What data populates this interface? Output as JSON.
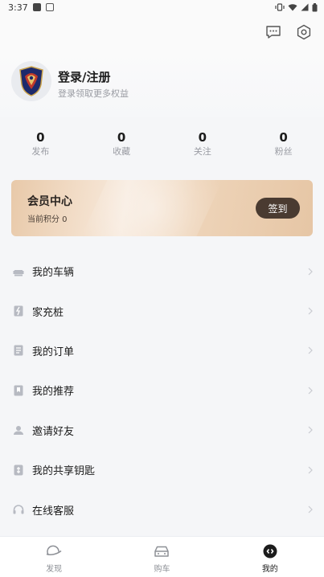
{
  "status_bar": {
    "time": "3:37"
  },
  "top_bar": {
    "message_icon": "message-icon",
    "settings_icon": "settings-icon"
  },
  "profile": {
    "title": "登录/注册",
    "subtitle": "登录领取更多权益"
  },
  "stats": [
    {
      "value": "0",
      "label": "发布"
    },
    {
      "value": "0",
      "label": "收藏"
    },
    {
      "value": "0",
      "label": "关注"
    },
    {
      "value": "0",
      "label": "粉丝"
    }
  ],
  "member": {
    "title": "会员中心",
    "points": "当前积分 0",
    "button": "签到"
  },
  "menu": [
    {
      "label": "我的车辆",
      "icon": "car-seat-icon"
    },
    {
      "label": "家充桩",
      "icon": "charger-icon"
    },
    {
      "label": "我的订单",
      "icon": "order-icon"
    },
    {
      "label": "我的推荐",
      "icon": "bookmark-icon"
    },
    {
      "label": "邀请好友",
      "icon": "user-icon"
    },
    {
      "label": "我的共享钥匙",
      "icon": "key-icon"
    },
    {
      "label": "在线客服",
      "icon": "headset-icon"
    }
  ],
  "tabs": [
    {
      "label": "发现",
      "icon": "discover-icon",
      "active": false
    },
    {
      "label": "购车",
      "icon": "car-icon",
      "active": false
    },
    {
      "label": "我的",
      "icon": "me-icon",
      "active": true
    }
  ]
}
